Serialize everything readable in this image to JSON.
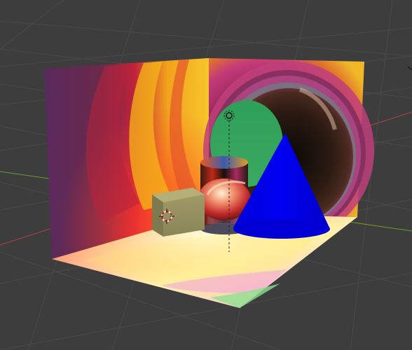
{
  "viewport": {
    "name": "3D Viewport",
    "background_color": "#3d3d3d",
    "grid_color": "#4a4a4a",
    "x_axis_color": "#b6414c",
    "y_axis_color": "#6e9a2c",
    "z_axis_color": "#5e7fb3"
  },
  "scene": {
    "objects": [
      {
        "type": "plane",
        "role": "floor"
      },
      {
        "type": "plane",
        "role": "back-left-wall"
      },
      {
        "type": "plane",
        "role": "back-right-wall"
      },
      {
        "type": "cylinder",
        "role": "reflective-cylinder"
      },
      {
        "type": "sphere",
        "role": "reflective-sphere"
      },
      {
        "type": "cube",
        "role": "selected-cube",
        "color": "#8f8a5a"
      },
      {
        "type": "cone",
        "role": "blue-cone",
        "color": "#0000e6"
      }
    ],
    "cursor": {
      "icon": "3d-cursor-icon"
    },
    "light": {
      "icon": "light-icon"
    }
  }
}
